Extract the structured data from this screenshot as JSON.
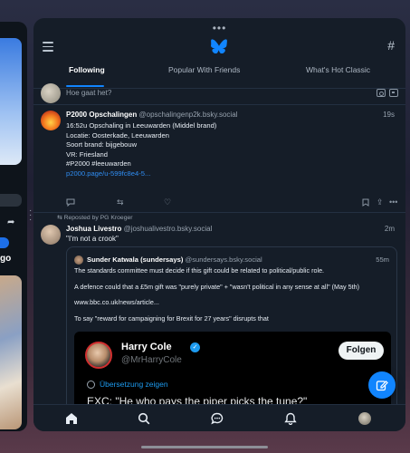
{
  "window": {
    "handle": "•••"
  },
  "tabs": [
    {
      "label": "Following",
      "active": true
    },
    {
      "label": "Popular With Friends",
      "active": false
    },
    {
      "label": "What's Hot Classic",
      "active": false
    }
  ],
  "composer": {
    "placeholder": "Hoe gaat het?"
  },
  "post1": {
    "name": "P2000 Opschalingen",
    "handle": "@opschalingenp2k.bsky.social",
    "time": "19s",
    "lines": [
      "16:52u Opschaling in Leeuwarden (Middel brand)",
      "Locatie: Oosterkade, Leeuwarden",
      "Soort brand: bijgebouw",
      "VR: Friesland",
      "#P2000 #leeuwarden"
    ],
    "link": "p2000.page/u-599fc8e4-5..."
  },
  "post2": {
    "repost": "Reposted by PG Kroeger",
    "name": "Joshua Livestro",
    "handle": "@joshualivestro.bsky.social",
    "time": "2m",
    "text": "\"I'm not a crook\"",
    "quote": {
      "name": "Sunder Katwala (sundersays)",
      "handle": "@sundersays.bsky.social",
      "time": "55m",
      "paragraphs": [
        "The standards committee must decide if this gift could be related to political/public role.",
        "A defence could that a £5m gift was \"purely private\" + \"wasn't political in any sense at all\" (May 5th)",
        "www.bbc.co.uk/news/article...",
        "To say \"reward for campaigning for Brexit for 27 years\" disrupts that"
      ],
      "embed": {
        "name": "Harry Cole",
        "handle": "@MrHarryCole",
        "follow": "Folgen",
        "translate": "Übersetzung zeigen",
        "text": "EXC: \"He who pays the piper picks the tune?\""
      }
    }
  },
  "left_window": {
    "label": "go"
  },
  "colors": {
    "accent": "#1185fe",
    "background": "#151d28",
    "divider": "#233041"
  }
}
